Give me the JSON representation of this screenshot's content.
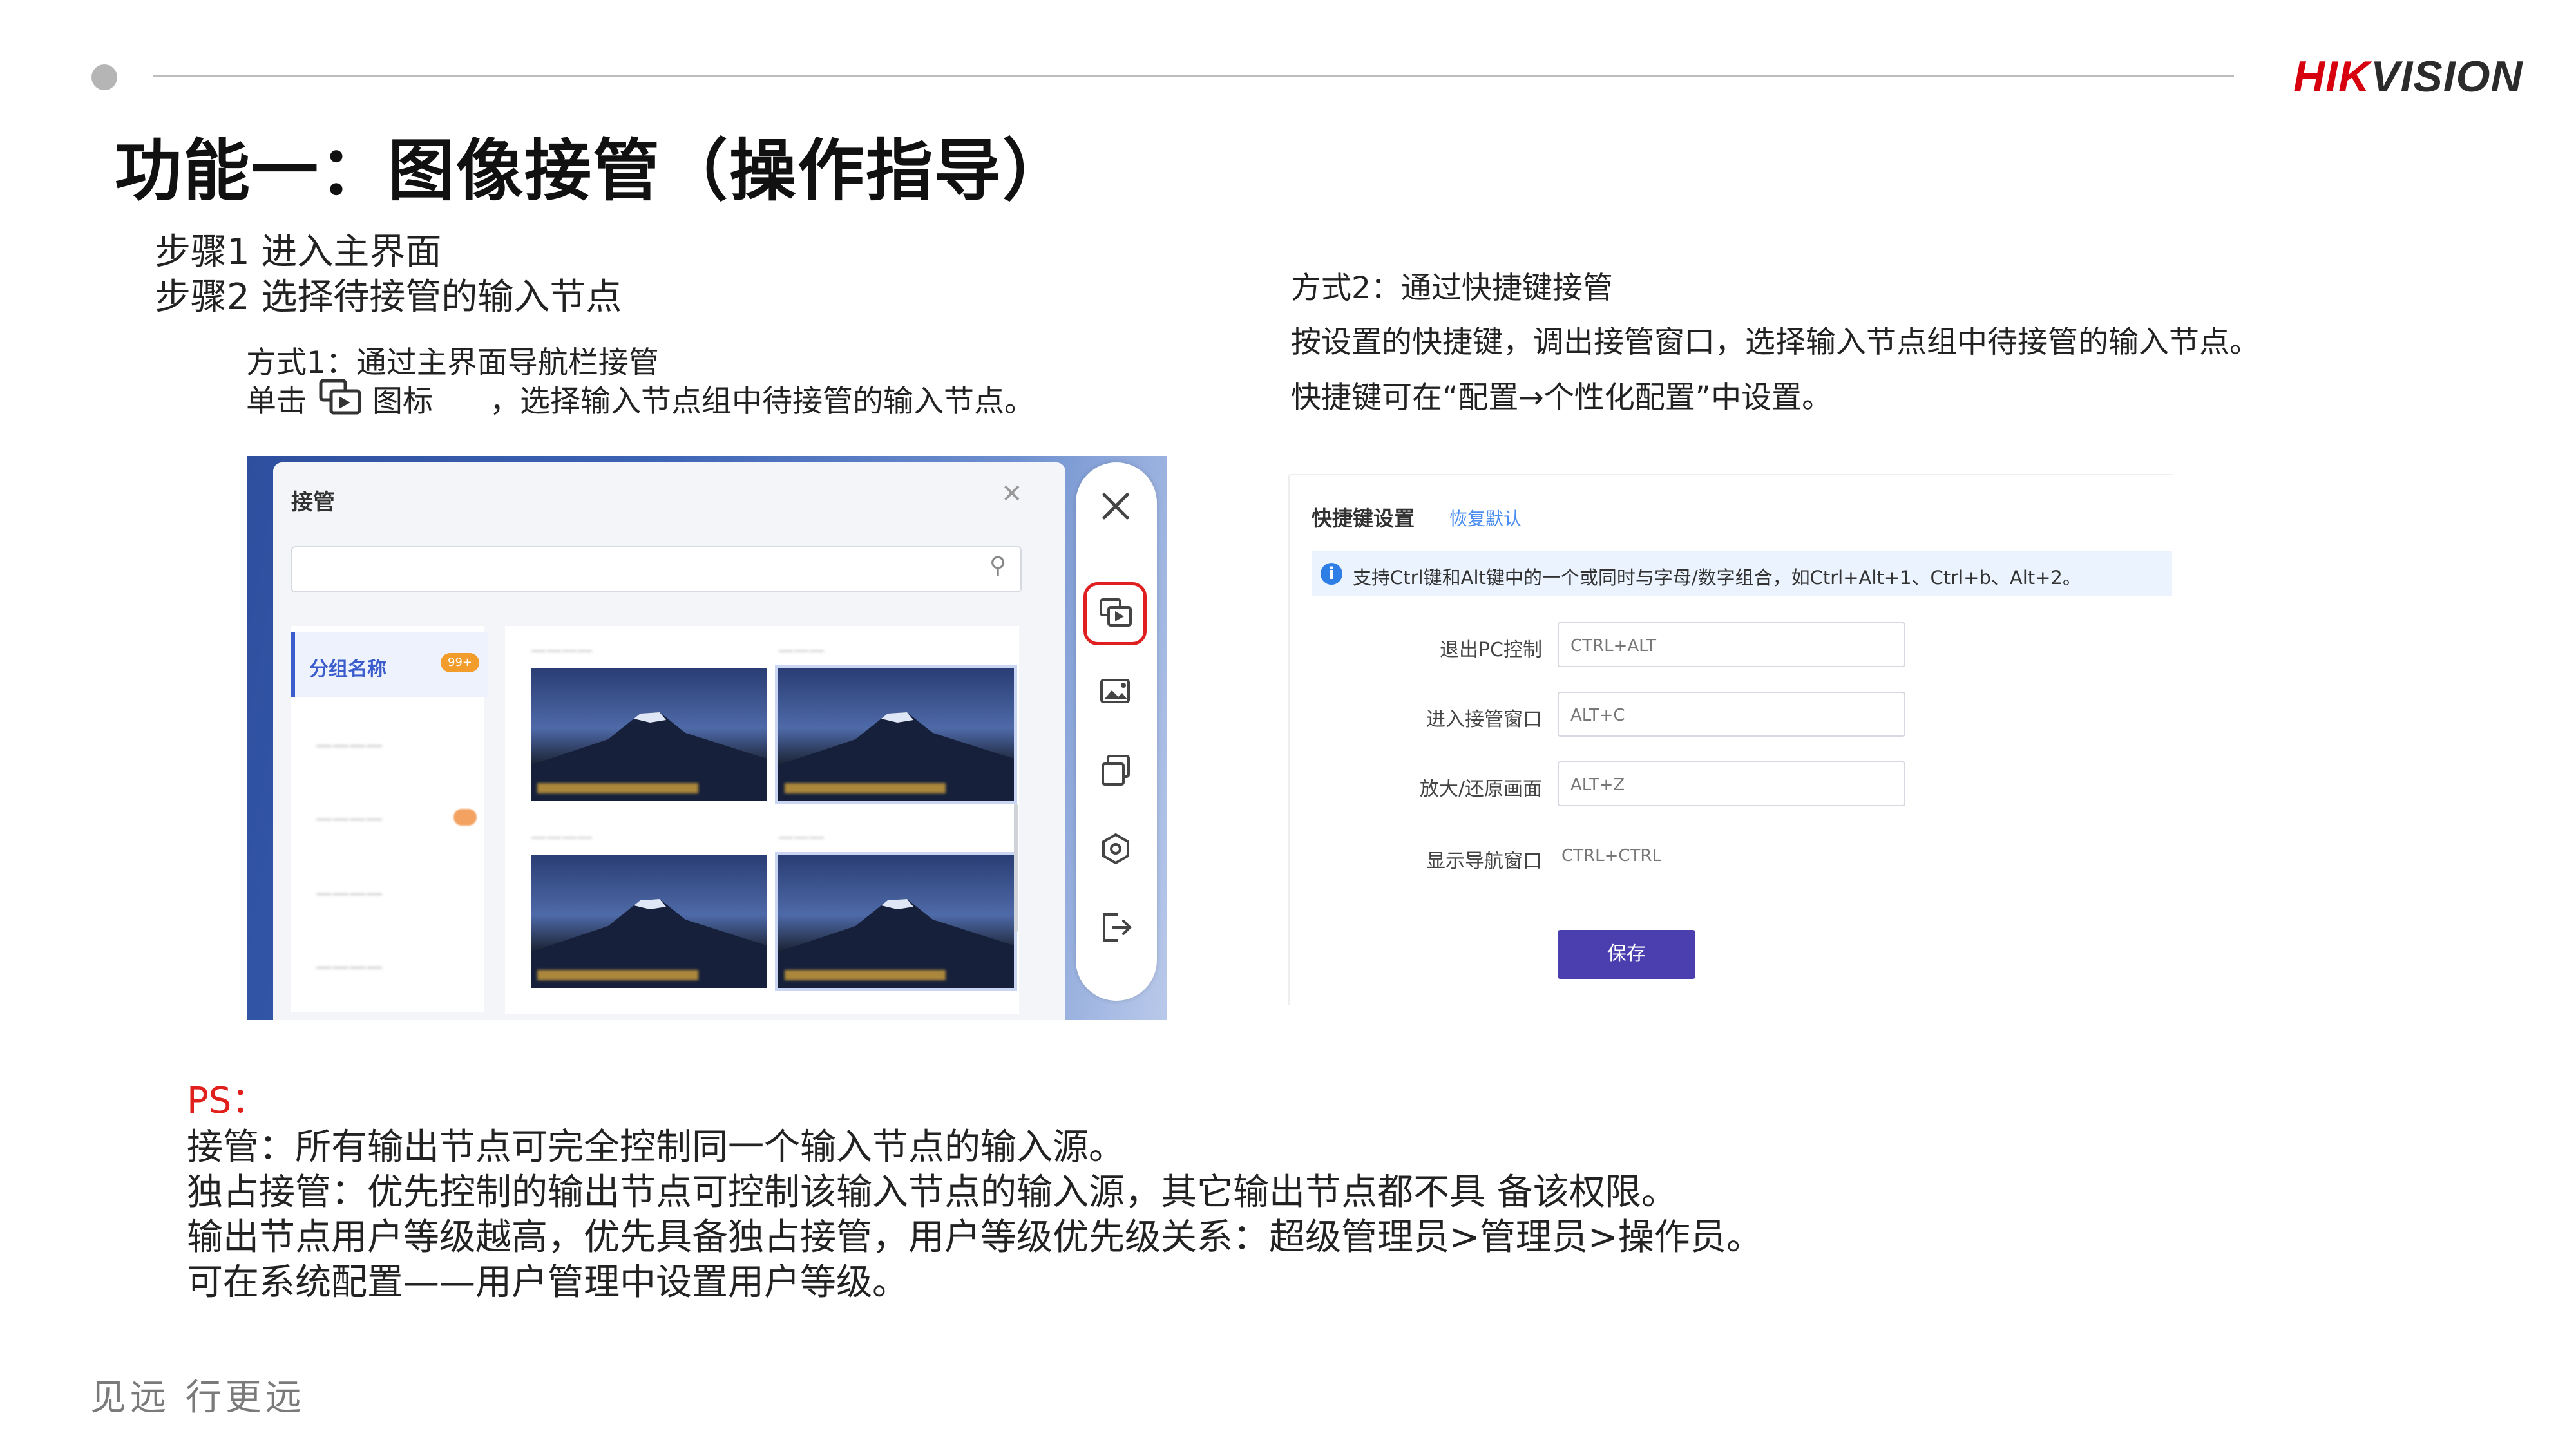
{
  "header": {
    "logo_hik": "HIK",
    "logo_vision": "VISION",
    "title": "功能一：图像接管（操作指导）"
  },
  "steps": {
    "step1": "步骤1 进入主界面",
    "step2": "步骤2 选择待接管的输入节点"
  },
  "method1": {
    "title": "方式1：通过主界面导航栏接管",
    "line_prefix": "单击",
    "line_icon_word": "图标",
    "line_suffix": "，选择输入节点组中待接管的输入节点。"
  },
  "method2": {
    "title": "方式2：通过快捷键接管",
    "line1": "按设置的快捷键，调出接管窗口，选择输入节点组中待接管的输入节点。",
    "line2": "快捷键可在“配置→个性化配置”中设置。"
  },
  "screenshot1": {
    "dialog_title": "接管",
    "group_active": "分组名称",
    "group_badge": "99+",
    "toolbar_icons": [
      "close-icon",
      "takeover-icon",
      "image-icon",
      "copy-windows-icon",
      "settings-icon",
      "logout-icon"
    ]
  },
  "screenshot2": {
    "title": "快捷键设置",
    "reset": "恢复默认",
    "info": "支持Ctrl键和Alt键中的一个或同时与字母/数字组合，如Ctrl+Alt+1、Ctrl+b、Alt+2。",
    "rows": [
      {
        "label": "退出PC控制",
        "value": "CTRL+ALT",
        "boxed": true
      },
      {
        "label": "进入接管窗口",
        "value": "ALT+C",
        "boxed": true
      },
      {
        "label": "放大/还原画面",
        "value": "ALT+Z",
        "boxed": true
      },
      {
        "label": "显示导航窗口",
        "value": "CTRL+CTRL",
        "boxed": false
      }
    ],
    "save": "保存",
    "info_icon_color": "#2e7ee6",
    "save_color": "#4b3fb0"
  },
  "notes": {
    "ps": "PS：",
    "lines": [
      "接管：所有输出节点可完全控制同一个输入节点的输入源。",
      "独占接管：优先控制的输出节点可控制该输入节点的输入源，其它输出节点都不具 备该权限。",
      "输出节点用户等级越高，优先具备独占接管，用户等级优先级关系：超级管理员>管理员>操作员。",
      "可在系统配置——用户管理中设置用户等级。"
    ],
    "ps_color": "#e0201b"
  },
  "footer": {
    "slogan": "见远 行更远"
  },
  "colors": {
    "brand_red": "#d7000f",
    "takeover_highlight": "#e02020",
    "accent_blue": "#3a5ccc"
  }
}
